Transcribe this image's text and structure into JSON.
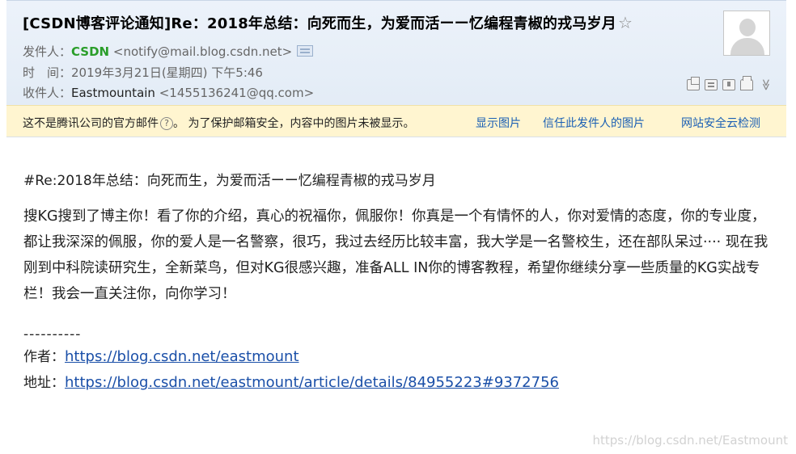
{
  "header": {
    "subject": "[CSDN博客评论通知]Re：2018年总结：向死而生，为爱而活ーー忆编程青椒的戎马岁月",
    "star_icon": "☆",
    "from_label": "发件人：",
    "from_name": "CSDN",
    "from_address": "<notify@mail.blog.csdn.net>",
    "time_label": "时　间：",
    "time_value": "2019年3月21日(星期四) 下午5:46",
    "to_label": "收件人：",
    "to_name": "Eastmountain",
    "to_address": "<1455136241@qq.com>",
    "more_icon": "≫"
  },
  "notice": {
    "not_official": "这不是腾讯公司的官方邮件",
    "help_icon": "?",
    "security_text": "。 为了保护邮箱安全，内容中的图片未被显示。",
    "show_images": "显示图片",
    "trust_sender": "信任此发件人的图片",
    "security_check": "网站安全云检测"
  },
  "content": {
    "title": "#Re:2018年总结：向死而生，为爱而活ーー忆编程青椒的戎马岁月",
    "body": "搜KG搜到了博主你！看了你的介绍，真心的祝福你，佩服你！你真是一个有情怀的人，你对爱情的态度，你的专业度，都让我深深的佩服，你的爱人是一名警察，很巧，我过去经历比较丰富，我大学是一名警校生，还在部队呆过···· 现在我刚到中科院读研究生，全新菜鸟，但对KG很感兴趣，准备ALL IN你的博客教程，希望你继续分享一些质量的KG实战专栏！我会一直关注你，向你学习！",
    "divider": "----------",
    "author_label": "作者：",
    "author_url": "https://blog.csdn.net/eastmount",
    "address_label": "地址：",
    "address_url": "https://blog.csdn.net/eastmount/article/details/84955223#9372756"
  },
  "watermark": "https://blog.csdn.net/Eastmount"
}
